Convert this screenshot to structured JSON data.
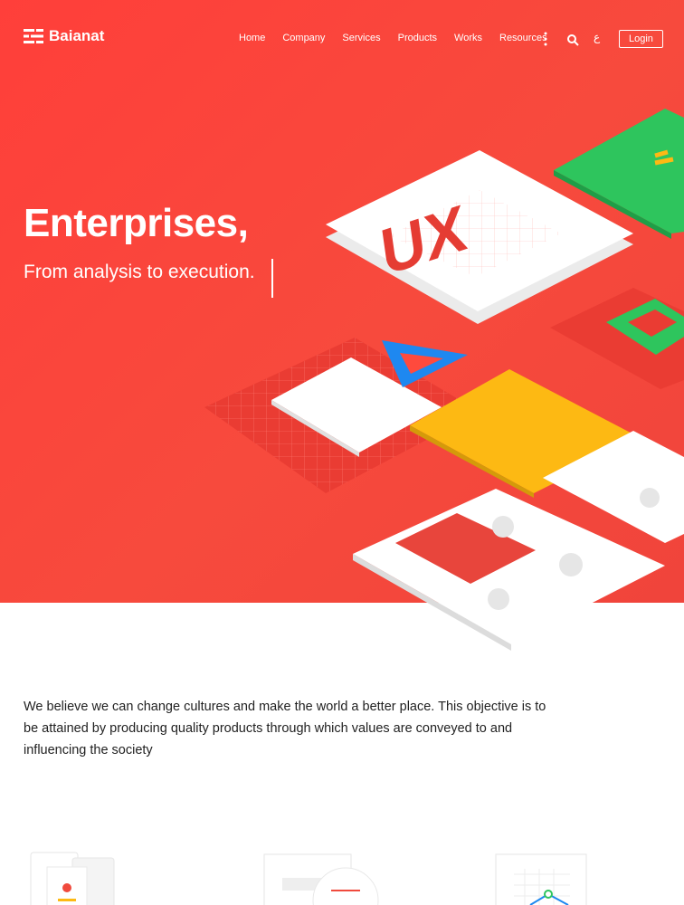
{
  "brand": {
    "name": "Baianat"
  },
  "nav": {
    "items": [
      "Home",
      "Company",
      "Services",
      "Products",
      "Works",
      "Resources"
    ],
    "lang": "ع",
    "login": "Login"
  },
  "hero": {
    "title": "Enterprises,",
    "subtitle": "From analysis to execution.",
    "art_text": "UX",
    "colors": {
      "background": "#f74a3d",
      "green": "#2ec55d",
      "yellow": "#fdb913",
      "blue": "#1e88f0"
    }
  },
  "about": {
    "text": "We believe we can change cultures and make the world a better place. This objective is to be attained by producing quality products through which values are conveyed to and influencing the society"
  }
}
